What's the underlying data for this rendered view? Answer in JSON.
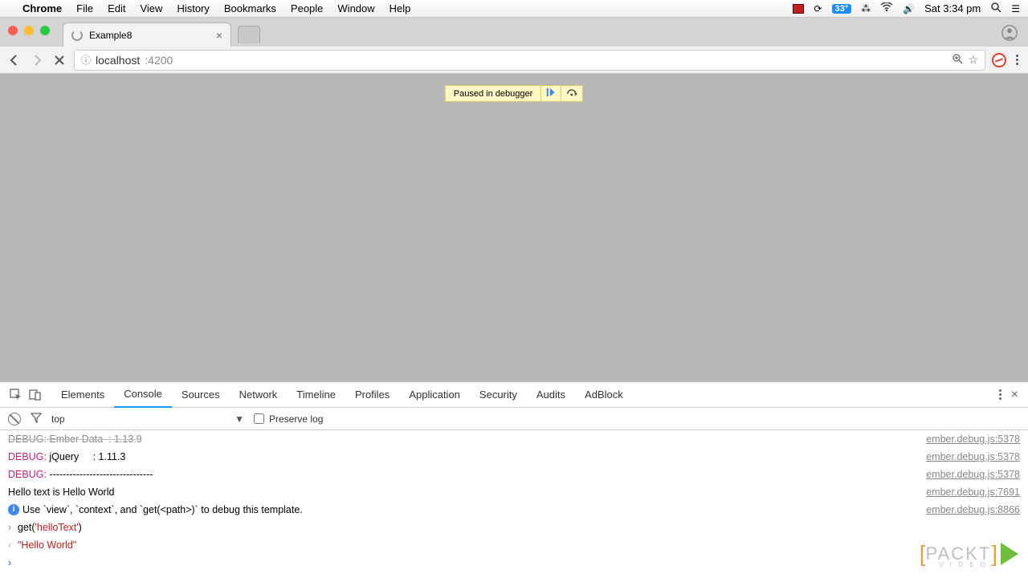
{
  "menubar": {
    "app": "Chrome",
    "items": [
      "File",
      "Edit",
      "View",
      "History",
      "Bookmarks",
      "People",
      "Window",
      "Help"
    ],
    "battery": "33°",
    "clock": "Sat 3:34 pm"
  },
  "browser": {
    "tab_title": "Example8",
    "url_host": "localhost",
    "url_port": ":4200"
  },
  "debugger_banner": {
    "message": "Paused in debugger"
  },
  "devtools": {
    "tabs": [
      "Elements",
      "Console",
      "Sources",
      "Network",
      "Timeline",
      "Profiles",
      "Application",
      "Security",
      "Audits",
      "AdBlock"
    ],
    "active_tab": "Console",
    "context": "top",
    "preserve_label": "Preserve log",
    "console_rows": [
      {
        "type": "cutoff",
        "text": "DEBUG: Ember Data  : 1.13.9",
        "src": "ember.debug.js:5378"
      },
      {
        "type": "debug",
        "prefix": "DEBUG: ",
        "text": "jQuery     : 1.11.3",
        "src": "ember.debug.js:5378"
      },
      {
        "type": "debug",
        "prefix": "DEBUG: ",
        "text": "-------------------------------",
        "src": "ember.debug.js:5378"
      },
      {
        "type": "plain",
        "text": "Hello text is Hello World",
        "src": "ember.debug.js:7691"
      },
      {
        "type": "info",
        "text": "Use `view`, `context`, and `get(<path>)` to debug this template.",
        "src": "ember.debug.js:8866"
      },
      {
        "type": "input",
        "pre": "get(",
        "str": "'helloText'",
        "post": ")"
      },
      {
        "type": "output",
        "str": "\"Hello World\""
      }
    ]
  },
  "watermark": {
    "brand": "PACKT",
    "sub": "V I D E O"
  }
}
